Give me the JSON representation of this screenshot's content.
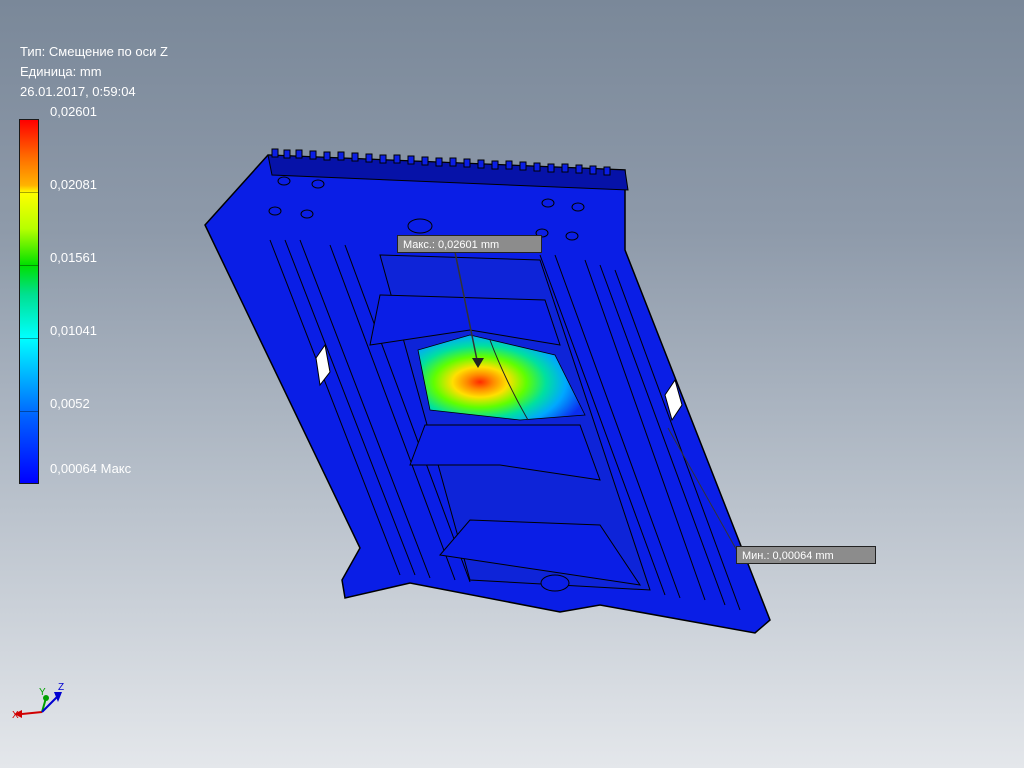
{
  "analysis": {
    "type_label": "Тип: Смещение по оси Z",
    "unit_label": "Единица: mm",
    "timestamp": "26.01.2017, 0:59:04"
  },
  "legend": {
    "values": [
      "0,02601",
      "0,02081",
      "0,01561",
      "0,01041",
      "0,0052",
      "0,00064 Макс"
    ],
    "max_color": "#ff0000",
    "min_color": "#0000ff"
  },
  "probes": {
    "max_label": "Макс.: 0,02601 mm",
    "min_label": "Мин.: 0,00064 mm"
  },
  "triad": {
    "x_label": "X",
    "y_label": "Y",
    "z_label": "Z"
  },
  "colors": {
    "part": "#0a1ee6",
    "part_dark": "#0612a8",
    "hotspot": "#ff3000"
  }
}
